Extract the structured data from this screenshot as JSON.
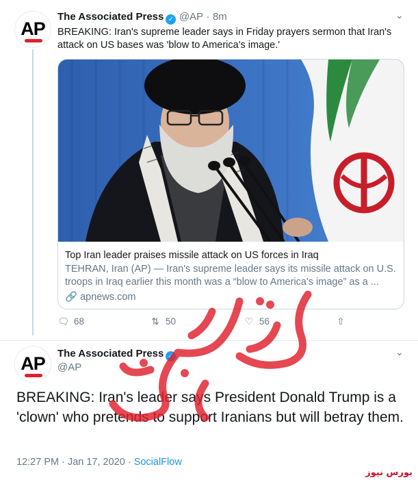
{
  "tweet1": {
    "author": "The Associated Press",
    "handle": "@AP",
    "time": "8m",
    "text": "BREAKING: Iran's supreme leader says in Friday prayers sermon that Iran's attack on US bases was 'blow to America's image.'",
    "card": {
      "title": "Top Iran leader praises missile attack on US forces in Iraq",
      "description": "TEHRAN, Iran (AP) — Iran's supreme leader says its missile attack on U.S. troops in Iraq earlier this month was a “blow to America's image” as a ...",
      "domain": "apnews.com"
    },
    "actions": {
      "replies": "68",
      "retweets": "50",
      "likes": "56"
    }
  },
  "tweet2": {
    "author": "The Associated Press",
    "handle": "@AP",
    "text": "BREAKING: Iran's leader says President Donald Trump is a 'clown' who pretends to support Iranians but will betray them.",
    "timestamp": "12:27 PM · Jan 17, 2020 · ",
    "source": "SocialFlow"
  },
  "avatar_text": "AP",
  "watermark": {
    "main": "بورس نیوز",
    "corner": "بورس نیوز"
  },
  "colors": {
    "accent": "#1da1f2",
    "link": "#1b95e0",
    "secondary_text": "#657786",
    "watermark": "#e0202d"
  },
  "icons": [
    "verified-badge-icon",
    "chevron-down-icon",
    "reply-icon",
    "retweet-icon",
    "like-icon",
    "share-icon",
    "link-icon"
  ]
}
